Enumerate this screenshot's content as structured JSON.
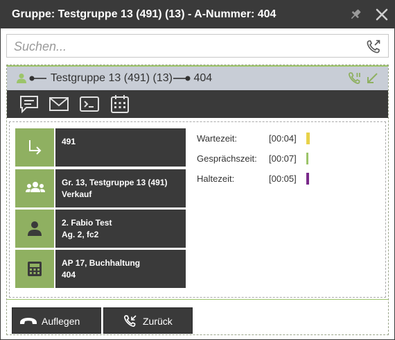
{
  "window": {
    "title": "Gruppe: Testgruppe 13 (491) (13) - A-Nummer: 404",
    "pin_icon": "pin-icon",
    "close_icon": "close-icon"
  },
  "search": {
    "placeholder": "Suchen...",
    "value": "",
    "icon": "phone-transfer-icon"
  },
  "group": {
    "name": "Testgruppe 13 (491) (13)",
    "number": "404",
    "icons": [
      "user-icon",
      "connection-icon",
      "phone-hold-icon",
      "arrow-down-left-icon"
    ]
  },
  "actions": [
    {
      "name": "chat-icon"
    },
    {
      "name": "mail-icon"
    },
    {
      "name": "terminal-icon"
    },
    {
      "name": "calendar-icon"
    }
  ],
  "info_rows": [
    {
      "icon": "forward-arrow-icon",
      "line1": "491",
      "line2": ""
    },
    {
      "icon": "group-icon",
      "line1": "Gr. 13, Testgruppe 13 (491)",
      "line2": "Verkauf"
    },
    {
      "icon": "person-icon",
      "line1": "2. Fabio Test",
      "line2": "Ag. 2, fc2"
    },
    {
      "icon": "desk-phone-icon",
      "line1": "AP 17, Buchhaltung",
      "line2": "404"
    }
  ],
  "timers": [
    {
      "label": "Wartezeit:",
      "value": "[00:04]",
      "color": "#e8d24a"
    },
    {
      "label": "Gesprächszeit:",
      "value": "[00:07]",
      "color": "#9cc46a"
    },
    {
      "label": "Haltezeit:",
      "value": "[00:05]",
      "color": "#7a2a8a"
    }
  ],
  "buttons": {
    "hangup": "Auflegen",
    "back": "Zurück"
  },
  "colors": {
    "dark": "#3a3a3a",
    "accent_green": "#8fb061",
    "group_bar": "#c8cdd6"
  }
}
